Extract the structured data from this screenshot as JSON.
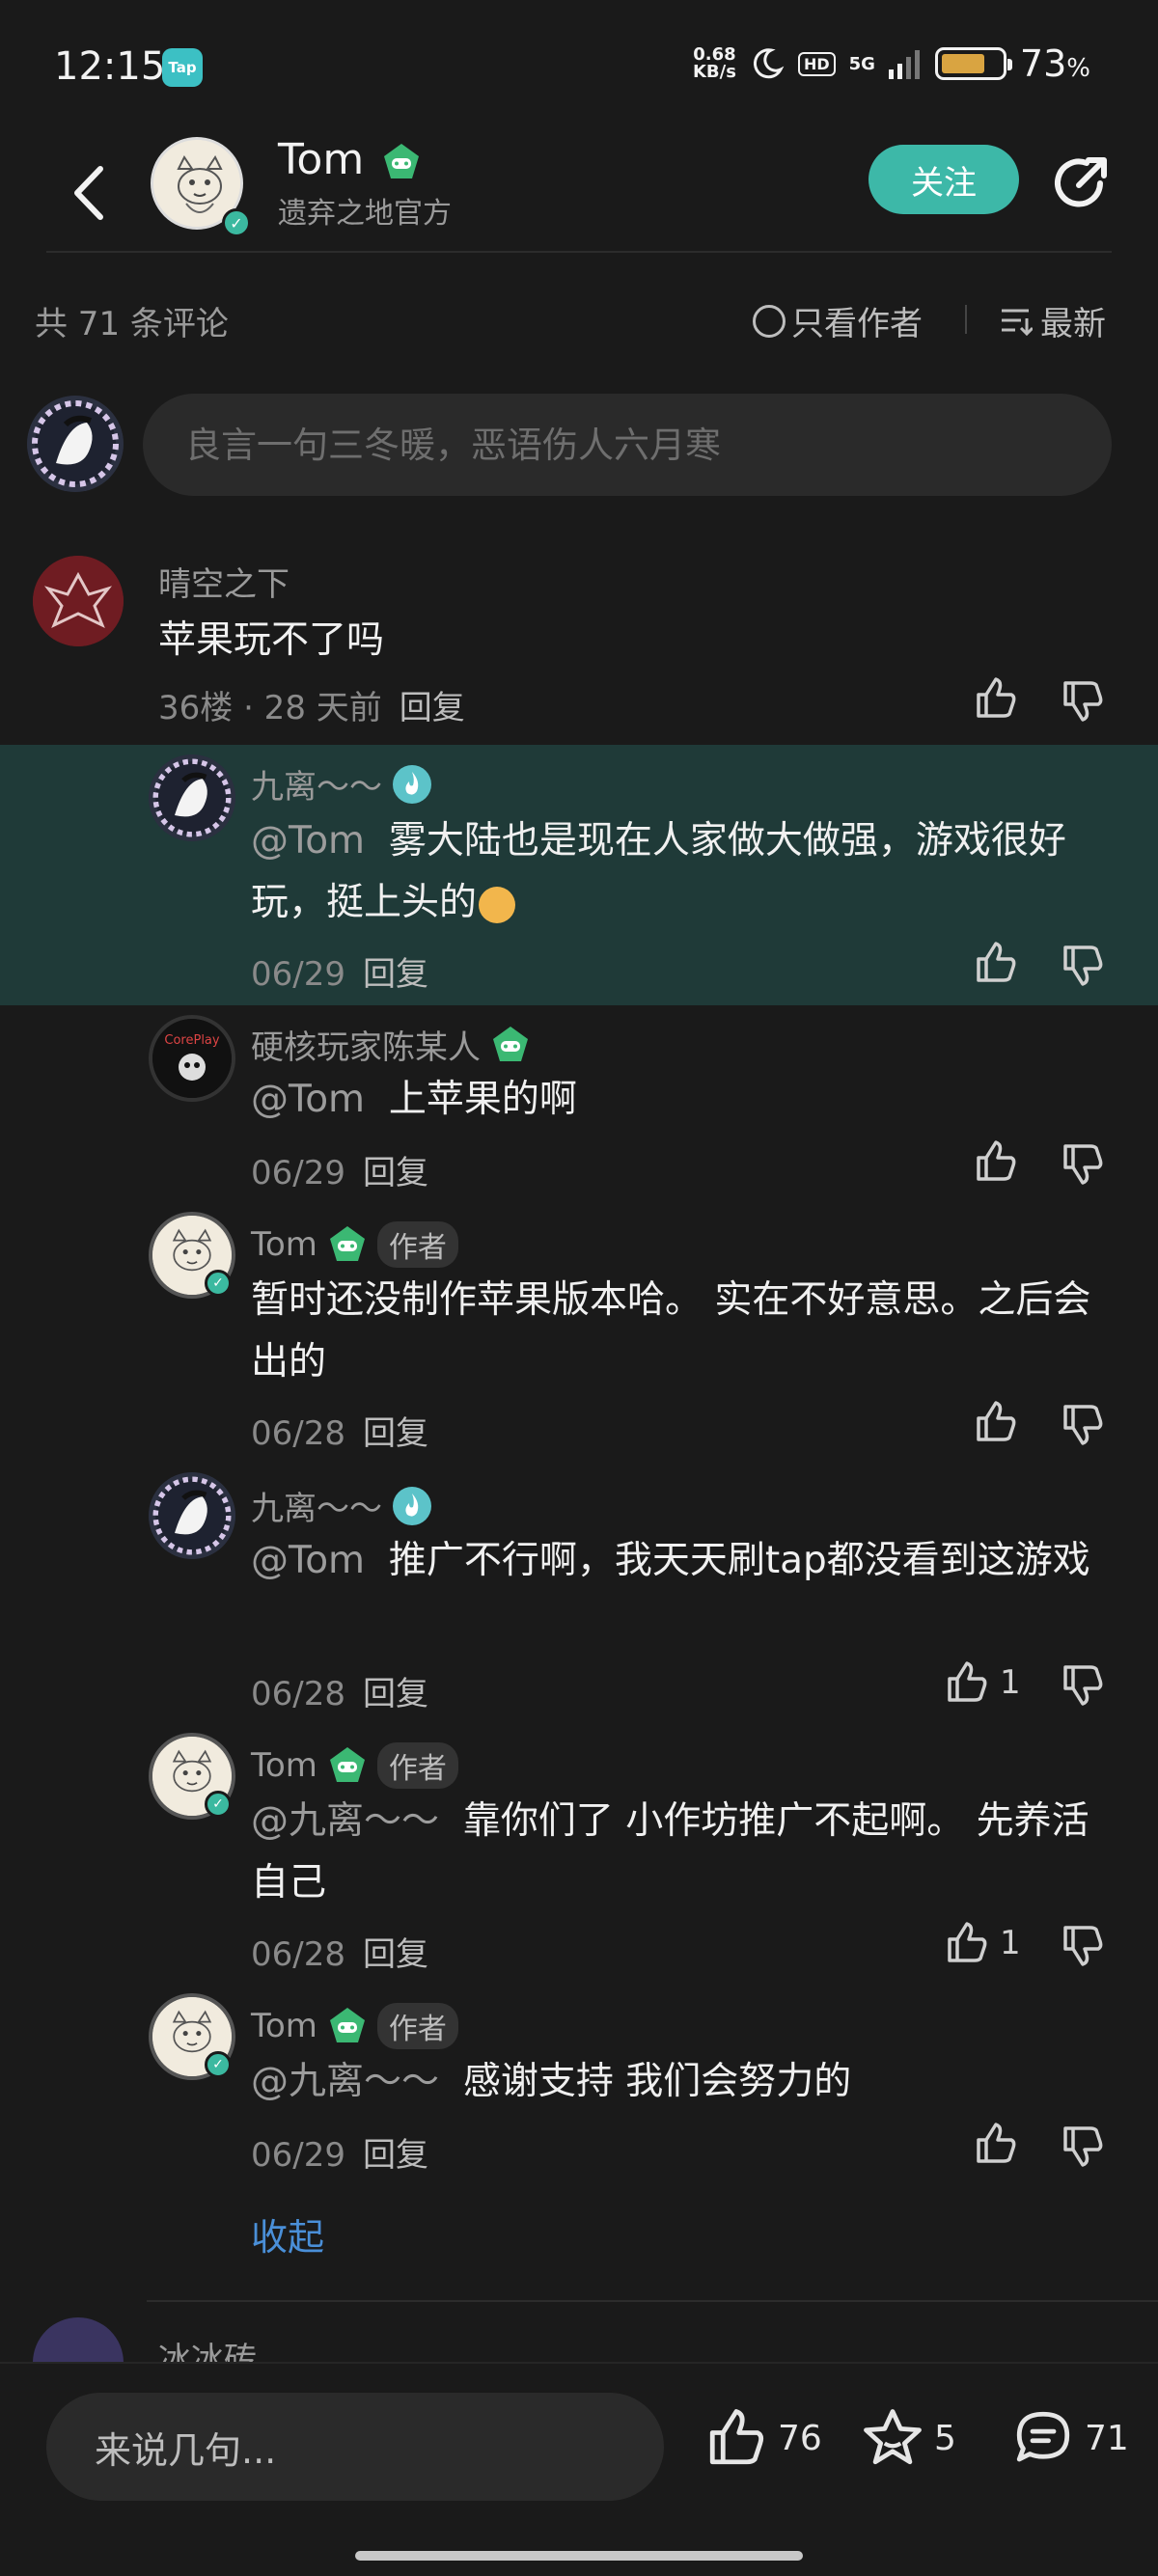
{
  "status_bar": {
    "time": "12:15",
    "app_badge": "Tap",
    "net_speed_value": "0.68",
    "net_speed_unit": "KB/s",
    "hd": "HD",
    "network": "5G",
    "battery_level": 0.73,
    "battery_text": "73",
    "battery_unit": "%"
  },
  "header": {
    "name": "Tom",
    "subtitle": "遗弃之地官方",
    "follow_label": "关注"
  },
  "comments_bar": {
    "count_text": "共 71 条评论",
    "only_author": "只看作者",
    "sort": "最新"
  },
  "input": {
    "placeholder": "良言一句三冬暖，恶语伤人六月寒"
  },
  "main_comment": {
    "user": "晴空之下",
    "text": "苹果玩不了吗",
    "meta": "36楼 · 28 天前",
    "reply": "回复"
  },
  "replies": [
    {
      "user": "九离～～",
      "mention": "@Tom",
      "text": "雾大陆也是现在人家做大做强，游戏很好玩，挺上头的",
      "date": "06/29",
      "reply": "回复",
      "likes": ""
    },
    {
      "user": "硬核玩家陈某人",
      "mention": "@Tom",
      "text": "上苹果的啊",
      "date": "06/29",
      "reply": "回复",
      "likes": ""
    },
    {
      "user": "Tom",
      "author_badge": "作者",
      "mention": "",
      "text": "暂时还没制作苹果版本哈。 实在不好意思。之后会出的",
      "date": "06/28",
      "reply": "回复",
      "likes": ""
    },
    {
      "user": "九离～～",
      "mention": "@Tom",
      "text": "推广不行啊，我天天刷tap都没看到这游戏",
      "date": "06/28",
      "reply": "回复",
      "likes": "1"
    },
    {
      "user": "Tom",
      "author_badge": "作者",
      "mention": "@九离～～",
      "text": "靠你们了   小作坊推广不起啊。 先养活自己",
      "date": "06/28",
      "reply": "回复",
      "likes": "1"
    },
    {
      "user": "Tom",
      "author_badge": "作者",
      "mention": "@九离～～",
      "text": "感谢支持 我们会努力的",
      "date": "06/29",
      "reply": "回复",
      "likes": ""
    }
  ],
  "collapse_label": "收起",
  "partial_next_user": "冰冰砖",
  "bottom_bar": {
    "input_placeholder": "来说几句...",
    "likes": "76",
    "stars": "5",
    "comments": "71"
  },
  "colors": {
    "accent": "#3db8a8",
    "highlight_bg": "#1f3a38",
    "link": "#4a8fd8"
  }
}
